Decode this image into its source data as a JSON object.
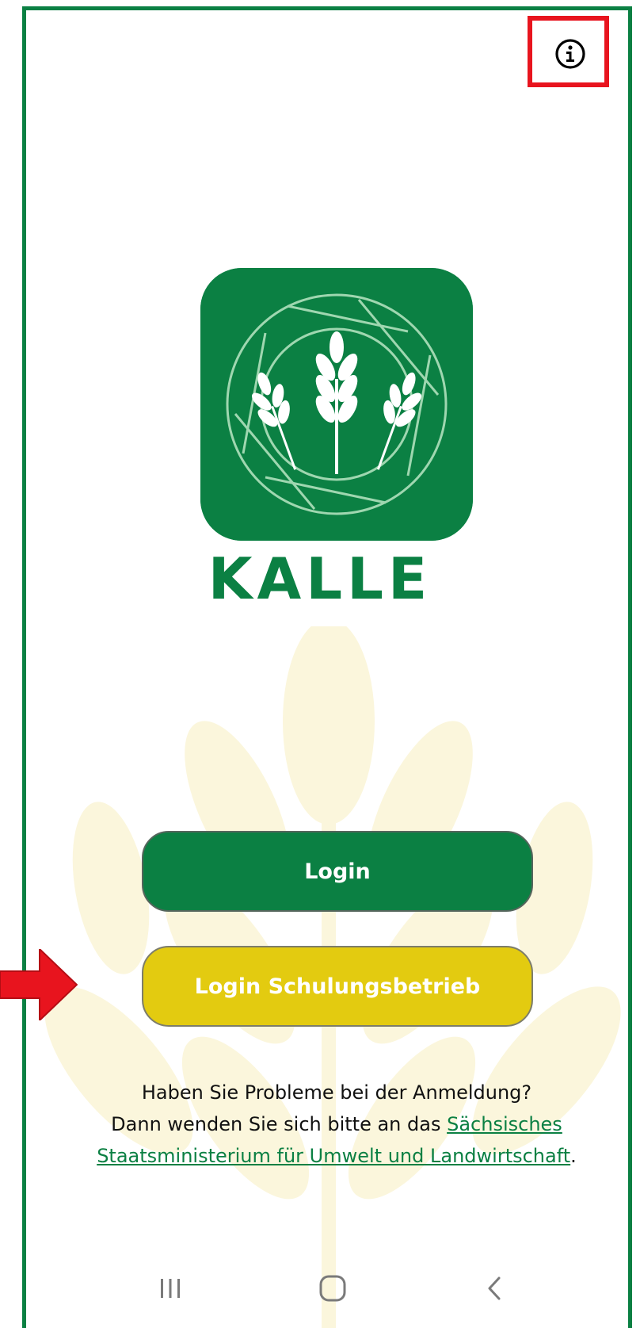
{
  "app": {
    "name": "KALLE"
  },
  "colors": {
    "brand_green": "#0b8043",
    "accent_yellow": "#e3cb10",
    "link_green": "#0b8043",
    "annotation_red": "#e8141e",
    "watermark_cream": "#fbf6dc"
  },
  "header": {
    "info_icon": "info-icon"
  },
  "buttons": {
    "login_label": "Login",
    "training_login_label": "Login Schulungsbetrieb"
  },
  "help": {
    "line1": "Haben Sie Probleme bei der Anmeldung?",
    "line2_prefix": "Dann wenden Sie sich bitte an das ",
    "link_text": "Sächsisches Staatsministerium für Umwelt und Landwirtschaft",
    "suffix": "."
  },
  "navbar": {
    "recents_icon": "recents-icon",
    "home_icon": "home-icon",
    "back_icon": "back-icon"
  }
}
